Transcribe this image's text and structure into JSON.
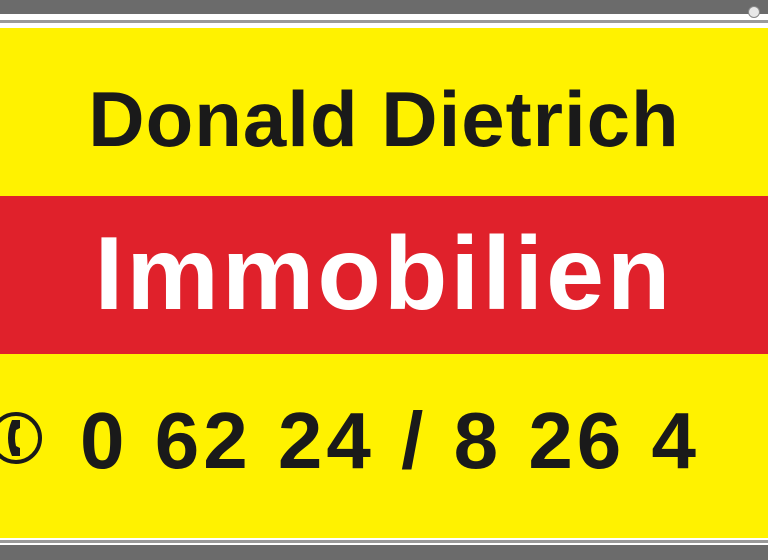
{
  "sign": {
    "name": "Donald Dietrich",
    "business": "Immobilien",
    "phone": "0 62 24 / 8 26 4",
    "phone_icon": "phone-handset-icon"
  },
  "colors": {
    "background": "#fff200",
    "band": "#e0212b",
    "name_text": "#1a1a1a",
    "band_text": "#ffffff",
    "frame": "#6b6b6b"
  }
}
